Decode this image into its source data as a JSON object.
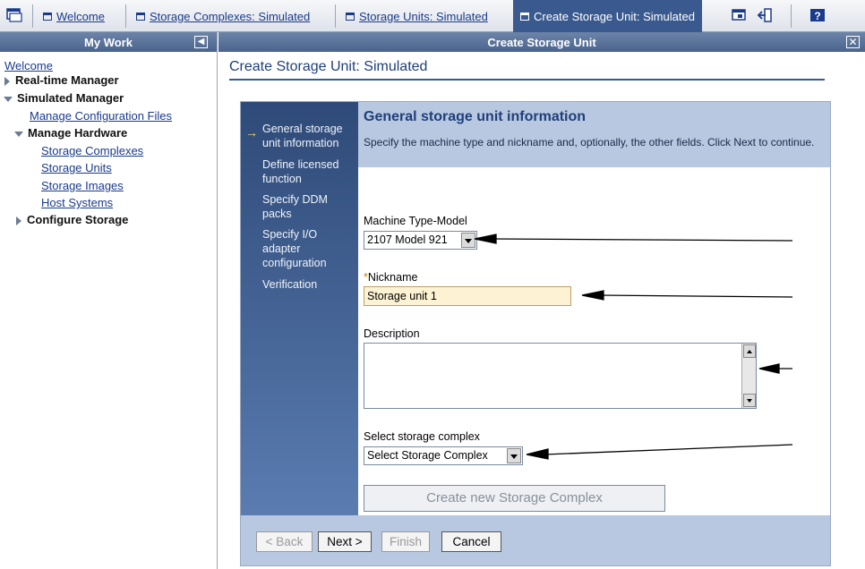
{
  "tabs": [
    {
      "label": "Welcome",
      "active": false
    },
    {
      "label": "Storage Complexes: Simulated",
      "active": false
    },
    {
      "label": "Storage Units: Simulated",
      "active": false
    },
    {
      "label": "Create Storage Unit: Simulated",
      "active": true
    }
  ],
  "nav": {
    "header": "My Work",
    "items": [
      {
        "label": "Welcome"
      },
      {
        "label": "Real-time Manager"
      },
      {
        "label": "Simulated Manager"
      },
      {
        "label": "Manage Configuration Files"
      },
      {
        "label": "Manage Hardware"
      },
      {
        "label": "Storage Complexes"
      },
      {
        "label": "Storage Units"
      },
      {
        "label": "Storage Images"
      },
      {
        "label": "Host Systems"
      },
      {
        "label": "Configure Storage"
      }
    ]
  },
  "main": {
    "header": "Create Storage Unit",
    "page_title": "Create Storage Unit: Simulated"
  },
  "wizard": {
    "steps": [
      {
        "label": "General storage unit information",
        "current": true
      },
      {
        "label": "Define licensed function"
      },
      {
        "label": "Specify DDM packs"
      },
      {
        "label": "Specify I/O adapter configuration"
      },
      {
        "label": "Verification"
      }
    ],
    "content_title": "General storage unit information",
    "content_desc": "Specify the machine type and nickname and, optionally, the other fields. Click Next to continue.",
    "fields": {
      "machine_type_label": "Machine Type-Model",
      "machine_type_value": "2107 Model 921",
      "nickname_required_mark": "*",
      "nickname_label": "Nickname",
      "nickname_value": "Storage unit 1",
      "description_label": "Description",
      "description_value": "",
      "storage_complex_label": "Select storage complex",
      "storage_complex_value": "Select Storage Complex",
      "create_complex_button": "Create new Storage Complex"
    },
    "buttons": {
      "back": "< Back",
      "next": "Next >",
      "finish": "Finish",
      "cancel": "Cancel"
    }
  },
  "colors": {
    "accent": "#3a5a8f",
    "link": "#1a3a8c",
    "panel": "#b8c8e0",
    "required_input_bg": "#fdf3d4"
  }
}
